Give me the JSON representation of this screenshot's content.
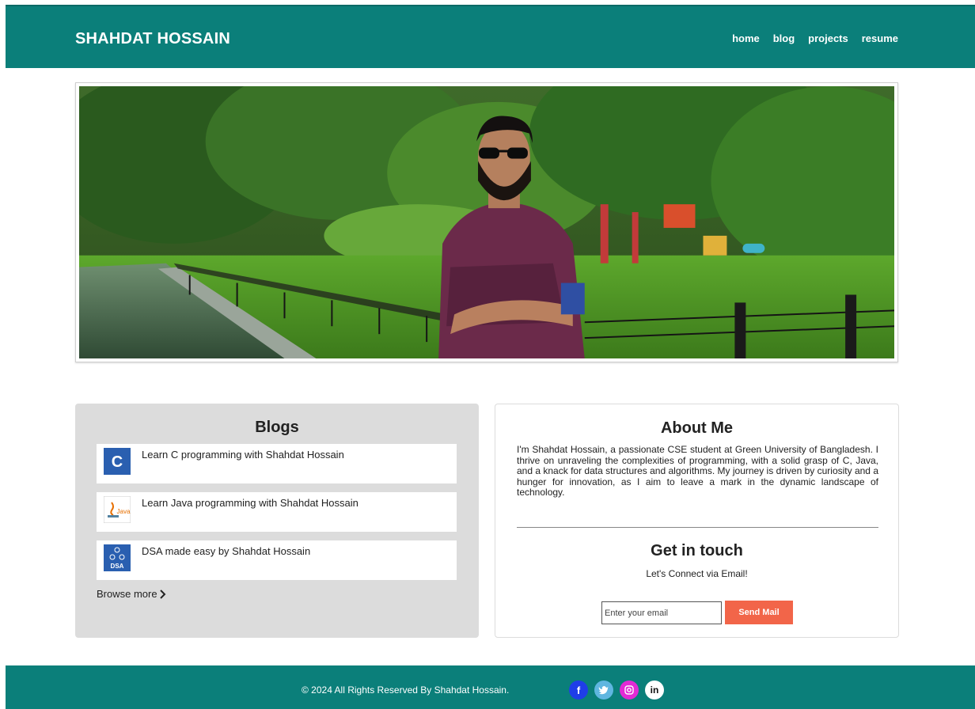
{
  "header": {
    "brand": "SHAHDAT HOSSAIN",
    "nav": [
      "home",
      "blog",
      "projects",
      "resume"
    ]
  },
  "blogs": {
    "title": "Blogs",
    "items": [
      {
        "label": "Learn C programming with Shahdat Hossain",
        "thumb": "c-programming-thumbnail",
        "thumb_text": "C"
      },
      {
        "label": "Learn Java programming with Shahdat Hossain",
        "thumb": "java-thumbnail",
        "thumb_text": "Java"
      },
      {
        "label": "DSA made easy by Shahdat Hossain",
        "thumb": "dsa-thumbnail",
        "thumb_text": "DSA"
      }
    ],
    "browse_more": "Browse more"
  },
  "about": {
    "title": "About Me",
    "text": "I'm Shahdat Hossain, a passionate CSE student at Green University of Bangladesh. I thrive on unraveling the complexities of programming, with a solid grasp of C, Java, and a knack for data structures and algorithms. My journey is driven by curiosity and a hunger for innovation, as I aim to leave a mark in the dynamic landscape of technology."
  },
  "contact": {
    "title": "Get in touch",
    "subtitle": "Let's Connect via Email!",
    "email_placeholder": "Enter your email",
    "send_label": "Send Mail"
  },
  "footer": {
    "copyright": "© 2024 All Rights Reserved By Shahdat Hossain.",
    "socials": [
      {
        "icon": "facebook-icon",
        "glyph": "f",
        "color": "#1f3ee8"
      },
      {
        "icon": "twitter-icon",
        "glyph": "t",
        "color": "#5fb6e0"
      },
      {
        "icon": "instagram-icon",
        "glyph": "◎",
        "color": "#e32ad5"
      },
      {
        "icon": "linkedin-icon",
        "glyph": "in",
        "color": "#ffffff"
      }
    ]
  },
  "colors": {
    "header_bg": "#0b7f7a",
    "send_button": "#f26549",
    "blogs_card_bg": "#dcdcdc"
  }
}
